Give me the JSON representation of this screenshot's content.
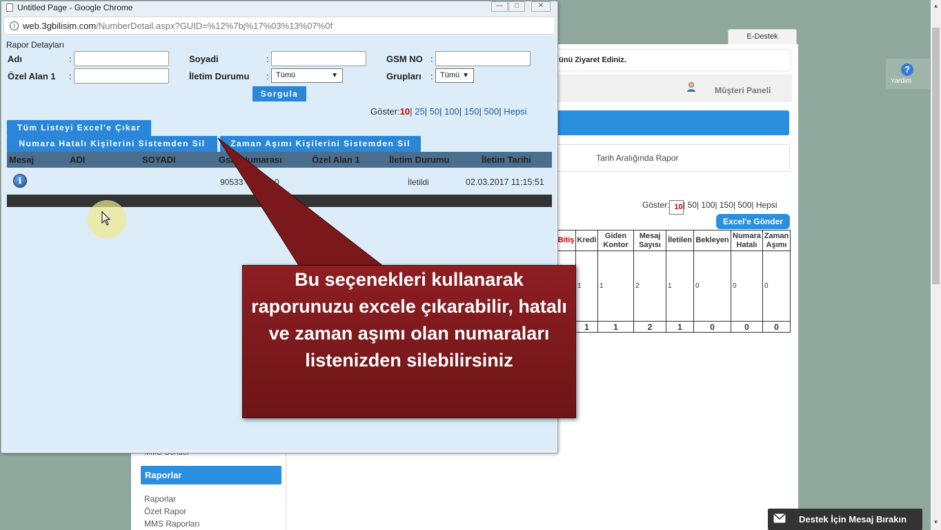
{
  "window": {
    "title": "Untitled Page - Google Chrome",
    "url_host": "web.3gbilisim.com",
    "url_path": "/NumberDetail.aspx?GUID=%12%7bj%17%03%13%07%0f"
  },
  "form": {
    "section_title": "Rapor Detayları",
    "adi_label": "Adı",
    "soyadi_label": "Soyadi",
    "gsm_label": "GSM NO",
    "ozel_label": "Özel Alan 1",
    "iletim_label": "İletim Durumu",
    "iletim_value": "Tümü",
    "gruplari_label": "Grupları",
    "gruplari_value": "Tümü",
    "sorgula_label": "Sorgula",
    "colon": ":"
  },
  "paging": {
    "prefix": "Göster:",
    "selected": "10",
    "options": [
      "25",
      "50",
      "100",
      "150",
      "500",
      "Hepsi"
    ],
    "sep": "|"
  },
  "actions": {
    "export_all": "Tüm Listeyi Excel'e Çıkar",
    "delete_wrong": "Numara Hatalı Kişilerini Sistemden Sil",
    "delete_timeout": "Zaman Aşımı Kişilerini Sistemden Sil"
  },
  "grid": {
    "columns": [
      "Mesaj",
      "ADI",
      "SOYADI",
      "Gsm Numarası",
      "Özel Alan 1",
      "İletim Durumu",
      "İletim Tarihi"
    ],
    "rows": [
      {
        "gsm": "90533",
        "gsm_tail": "0",
        "status": "İletildi",
        "date": "02.03.2017 11:15:51"
      }
    ]
  },
  "callout": {
    "lines": [
      "Bu seçenekleri kullanarak",
      "raporunuzu excele çıkarabilir, hatalı",
      "ve zaman aşımı olan numaraları",
      "listenizden silebilirsiniz"
    ]
  },
  "background": {
    "tab_label": "E-Destek",
    "visit_text": "ünü Ziyaret Ediniz.",
    "musteri_paneli": "Müşteri Paneli",
    "tarih_text": "Tarih Aralığında Rapor",
    "goster_prefix": "Göster:",
    "goster_selected": "10",
    "goster_rest": "| 25| 50| 100| 150| 500| Hepsi",
    "excel_button": "Excel'e Gönder",
    "table_headers": [
      "Bitiş",
      "Kredi",
      "Giden Kontor",
      "Mesaj Sayısı",
      "İletilen",
      "Bekleyen",
      "Numara Hatalı",
      "Zaman Aşımı"
    ],
    "table_values": [
      "",
      "1",
      "1",
      "2",
      "1",
      "0",
      "0",
      "0"
    ],
    "table_totals": [
      "",
      "1",
      "1",
      "2",
      "1",
      "0",
      "0",
      "0"
    ],
    "raporlar_head": "Raporlar",
    "left_links": [
      "Raporlar",
      "Özet Rapor",
      "MMS Raporları"
    ],
    "mms_sender": "MMS Gönder",
    "yardim": "Yardim",
    "destek_btn": "Destek İçin Mesaj Bırakın"
  }
}
